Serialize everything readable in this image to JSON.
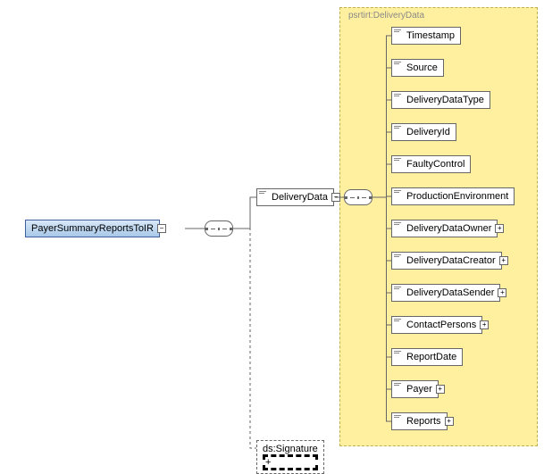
{
  "root": {
    "label": "PayerSummaryReportsToIR"
  },
  "deliveryData": {
    "label": "DeliveryData"
  },
  "signature": {
    "label": "ds:Signature"
  },
  "namespace": {
    "label": "psrtirt:DeliveryData"
  },
  "children": [
    {
      "label": "Timestamp"
    },
    {
      "label": "Source"
    },
    {
      "label": "DeliveryDataType"
    },
    {
      "label": "DeliveryId"
    },
    {
      "label": "FaultyControl"
    },
    {
      "label": "ProductionEnvironment"
    },
    {
      "label": "DeliveryDataOwner"
    },
    {
      "label": "DeliveryDataCreator"
    },
    {
      "label": "DeliveryDataSender"
    },
    {
      "label": "ContactPersons"
    },
    {
      "label": "ReportDate"
    },
    {
      "label": "Payer"
    },
    {
      "label": "Reports"
    }
  ],
  "expandable_children": [
    false,
    false,
    false,
    false,
    false,
    false,
    true,
    true,
    true,
    true,
    false,
    true,
    true
  ],
  "plus_glyph": "+"
}
